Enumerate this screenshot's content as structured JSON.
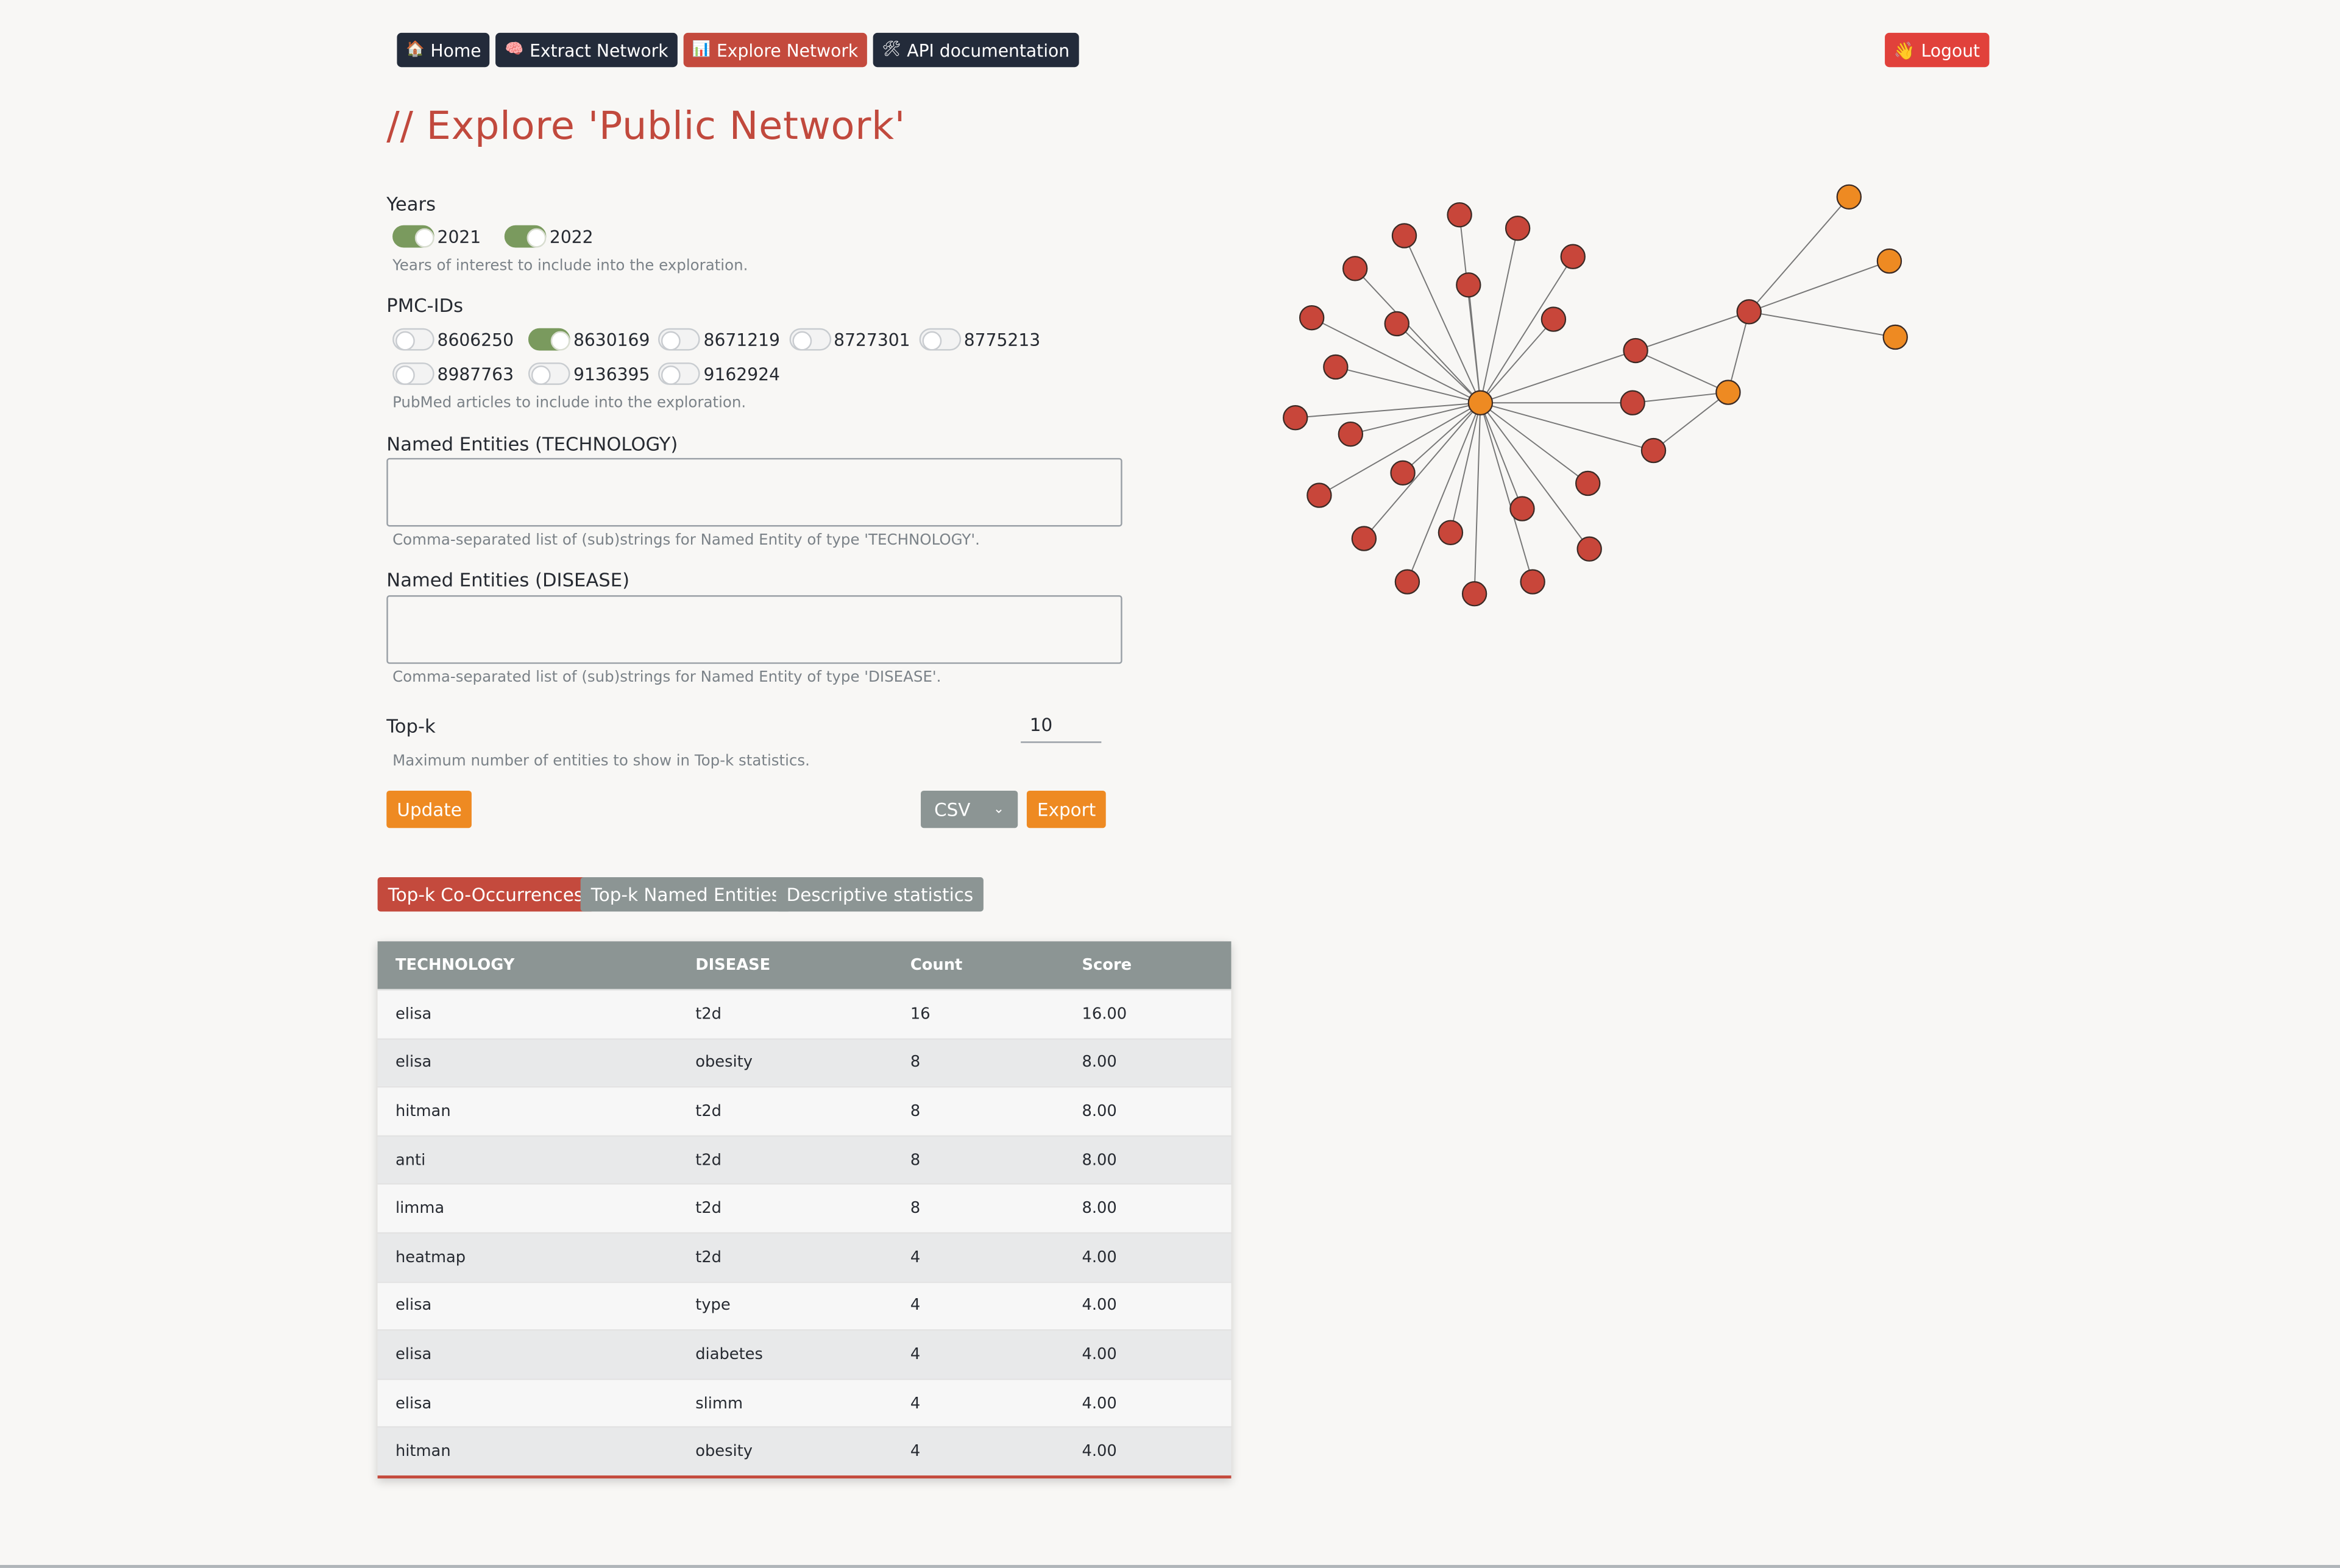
{
  "nav": {
    "items": [
      {
        "icon": "🏠",
        "icon_name": "home-icon",
        "label": "Home"
      },
      {
        "icon": "🧠",
        "icon_name": "brain-icon",
        "label": "Extract Network"
      },
      {
        "icon": "📊",
        "icon_name": "chart-icon",
        "label": "Explore Network"
      },
      {
        "icon": "🛠",
        "icon_name": "tools-icon",
        "label": "API documentation"
      }
    ],
    "logout": {
      "icon": "👋",
      "label": "Logout"
    }
  },
  "page_title": "// Explore 'Public Network'",
  "years": {
    "label": "Years",
    "help": "Years of interest to include into the exploration.",
    "options": [
      {
        "label": "2021",
        "checked": true
      },
      {
        "label": "2022",
        "checked": true
      }
    ]
  },
  "pmc": {
    "label": "PMC-IDs",
    "help": "PubMed articles to include into the exploration.",
    "row1": [
      {
        "label": "8606250",
        "checked": false
      },
      {
        "label": "8630169",
        "checked": true
      },
      {
        "label": "8671219",
        "checked": false
      },
      {
        "label": "8727301",
        "checked": false
      },
      {
        "label": "8775213",
        "checked": false
      }
    ],
    "row2": [
      {
        "label": "8987763",
        "checked": false
      },
      {
        "label": "9136395",
        "checked": false
      },
      {
        "label": "9162924",
        "checked": false
      }
    ]
  },
  "technology": {
    "label": "Named Entities (TECHNOLOGY)",
    "value": "",
    "help": "Comma-separated list of (sub)strings for Named Entity of type 'TECHNOLOGY'."
  },
  "disease": {
    "label": "Named Entities (DISEASE)",
    "value": "",
    "help": "Comma-separated list of (sub)strings for Named Entity of type 'DISEASE'."
  },
  "topk": {
    "label": "Top-k",
    "value": "10",
    "help": "Maximum number of entities to show in Top-k statistics."
  },
  "actions": {
    "update": "Update",
    "format": "CSV",
    "export": "Export"
  },
  "tabs": [
    {
      "label": "Top-k Co-Occurrences",
      "active": true
    },
    {
      "label": "Top-k Named Entities",
      "active": false
    },
    {
      "label": "Descriptive statistics",
      "active": false
    }
  ],
  "table": {
    "headers": [
      "TECHNOLOGY",
      "DISEASE",
      "Count",
      "Score"
    ],
    "rows": [
      [
        "elisa",
        "t2d",
        "16",
        "16.00"
      ],
      [
        "elisa",
        "obesity",
        "8",
        "8.00"
      ],
      [
        "hitman",
        "t2d",
        "8",
        "8.00"
      ],
      [
        "anti",
        "t2d",
        "8",
        "8.00"
      ],
      [
        "limma",
        "t2d",
        "8",
        "8.00"
      ],
      [
        "heatmap",
        "t2d",
        "4",
        "4.00"
      ],
      [
        "elisa",
        "type",
        "4",
        "4.00"
      ],
      [
        "elisa",
        "diabetes",
        "4",
        "4.00"
      ],
      [
        "elisa",
        "slimm",
        "4",
        "4.00"
      ],
      [
        "hitman",
        "obesity",
        "4",
        "4.00"
      ]
    ]
  },
  "graph": {
    "colors": {
      "technology": "#ee8a22",
      "disease": "#c8463a",
      "edge": "#777777"
    }
  }
}
